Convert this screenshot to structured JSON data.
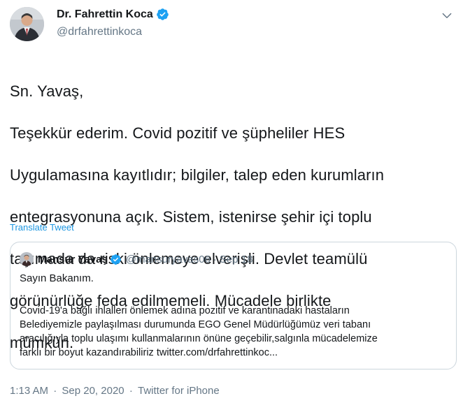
{
  "tweet": {
    "author_name": "Dr. Fahrettin Koca",
    "author_handle": "@drfahrettinkoca",
    "lines": [
      "Sn. Yavaş,",
      "Teşekkür ederim. Covid pozitif ve şüpheliler HES",
      "Uygulamasına kayıtlıdır; bilgiler, talep eden kurumların",
      "entegrasyonuna açık. Sistem, istenirse şehir içi toplu",
      "taşımada da riski önlemeye elverişli. Devlet teamülü",
      "görünürlüğe feda edilmemeli. Mücadele birlikte",
      "mümkün."
    ],
    "translate_label": "Translate Tweet",
    "time": "1:13 AM",
    "date": "Sep 20, 2020",
    "source": "Twitter for iPhone",
    "separator": "·"
  },
  "quote": {
    "author_name": "Mansur Yavaş",
    "author_handle": "@mansuryavas06",
    "separator": "·",
    "date": "Sep 18",
    "greeting": "Sayın Bakanım.",
    "lines": [
      "Covid-19'a bağlı  ihlalleri önlemek adına pozitif ve karantinadaki hastaların",
      "Belediyemizle paylaşılması durumunda EGO Genel Müdürlüğümüz veri tabanı",
      "aracılığıyla toplu ulaşımı kullanmalarının önüne geçebilir,salgınla mücadelemize",
      "farklı bir boyut kazandırabiliriz twitter.com/drfahrettinkoc..."
    ]
  },
  "icons": {
    "verified": "verified-badge-icon",
    "more": "chevron-down-icon"
  },
  "colors": {
    "link": "#1b95e0",
    "verified": "#1da1f2",
    "secondary_text": "#657786",
    "border": "#ccd6dd"
  }
}
